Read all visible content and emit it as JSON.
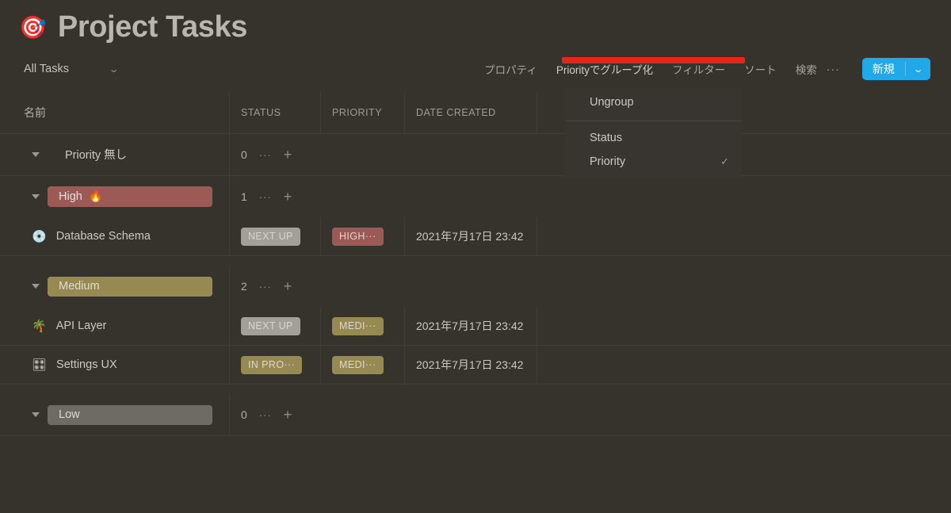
{
  "header": {
    "emoji": "🎯",
    "emoji_name": "dart-target-emoji",
    "title": "Project Tasks"
  },
  "toolbar": {
    "view_label": "All Tasks",
    "view_caret": "⌄",
    "properties_label": "プロパティ",
    "group_by_label": "Priorityでグループ化",
    "filter_label": "フィルター",
    "sort_label": "ソート",
    "search_label": "検索",
    "more_label": "···",
    "new_label": "新規",
    "new_caret": "⌄"
  },
  "group_menu": {
    "ungroup_label": "Ungroup",
    "items": [
      {
        "label": "Status",
        "checked": ""
      },
      {
        "label": "Priority",
        "checked": "✓"
      }
    ],
    "border_color": "#e8251b"
  },
  "table": {
    "columns": [
      {
        "label": "名前"
      },
      {
        "label": "STATUS"
      },
      {
        "label": "PRIORITY"
      },
      {
        "label": "DATE CREATED"
      }
    ],
    "groups": [
      {
        "name": "Priority 無し",
        "style": "plain",
        "count": "0",
        "dots": "···",
        "plus": "+",
        "rows": []
      },
      {
        "name": "High",
        "emoji": "🔥",
        "style": "high",
        "count": "1",
        "dots": "···",
        "plus": "+",
        "rows": [
          {
            "emoji": "💿",
            "name": "Database Schema",
            "status": "NEXT UP",
            "status_style": "gray",
            "priority": "HIGH···",
            "priority_style": "high",
            "date": "2021年7月17日 23:42"
          }
        ]
      },
      {
        "name": "Medium",
        "emoji": "",
        "style": "medium",
        "count": "2",
        "dots": "···",
        "plus": "+",
        "rows": [
          {
            "emoji": "🌴",
            "name": "API Layer",
            "status": "NEXT UP",
            "status_style": "gray",
            "priority": "MEDI···",
            "priority_style": "medium",
            "date": "2021年7月17日 23:42"
          },
          {
            "emoji": "🎛",
            "name": "Settings UX",
            "status": "IN PRO···",
            "status_style": "medium",
            "priority": "MEDI···",
            "priority_style": "medium",
            "date": "2021年7月17日 23:42"
          }
        ]
      },
      {
        "name": "Low",
        "emoji": "",
        "style": "low",
        "count": "0",
        "dots": "···",
        "plus": "+",
        "rows": []
      }
    ]
  },
  "colors": {
    "background": "#36322c",
    "high": "#9c5a56",
    "medium": "#968a52",
    "low": "#6e6b64",
    "gray_badge": "#a3a09a",
    "accent_blue": "#20a8e8"
  }
}
